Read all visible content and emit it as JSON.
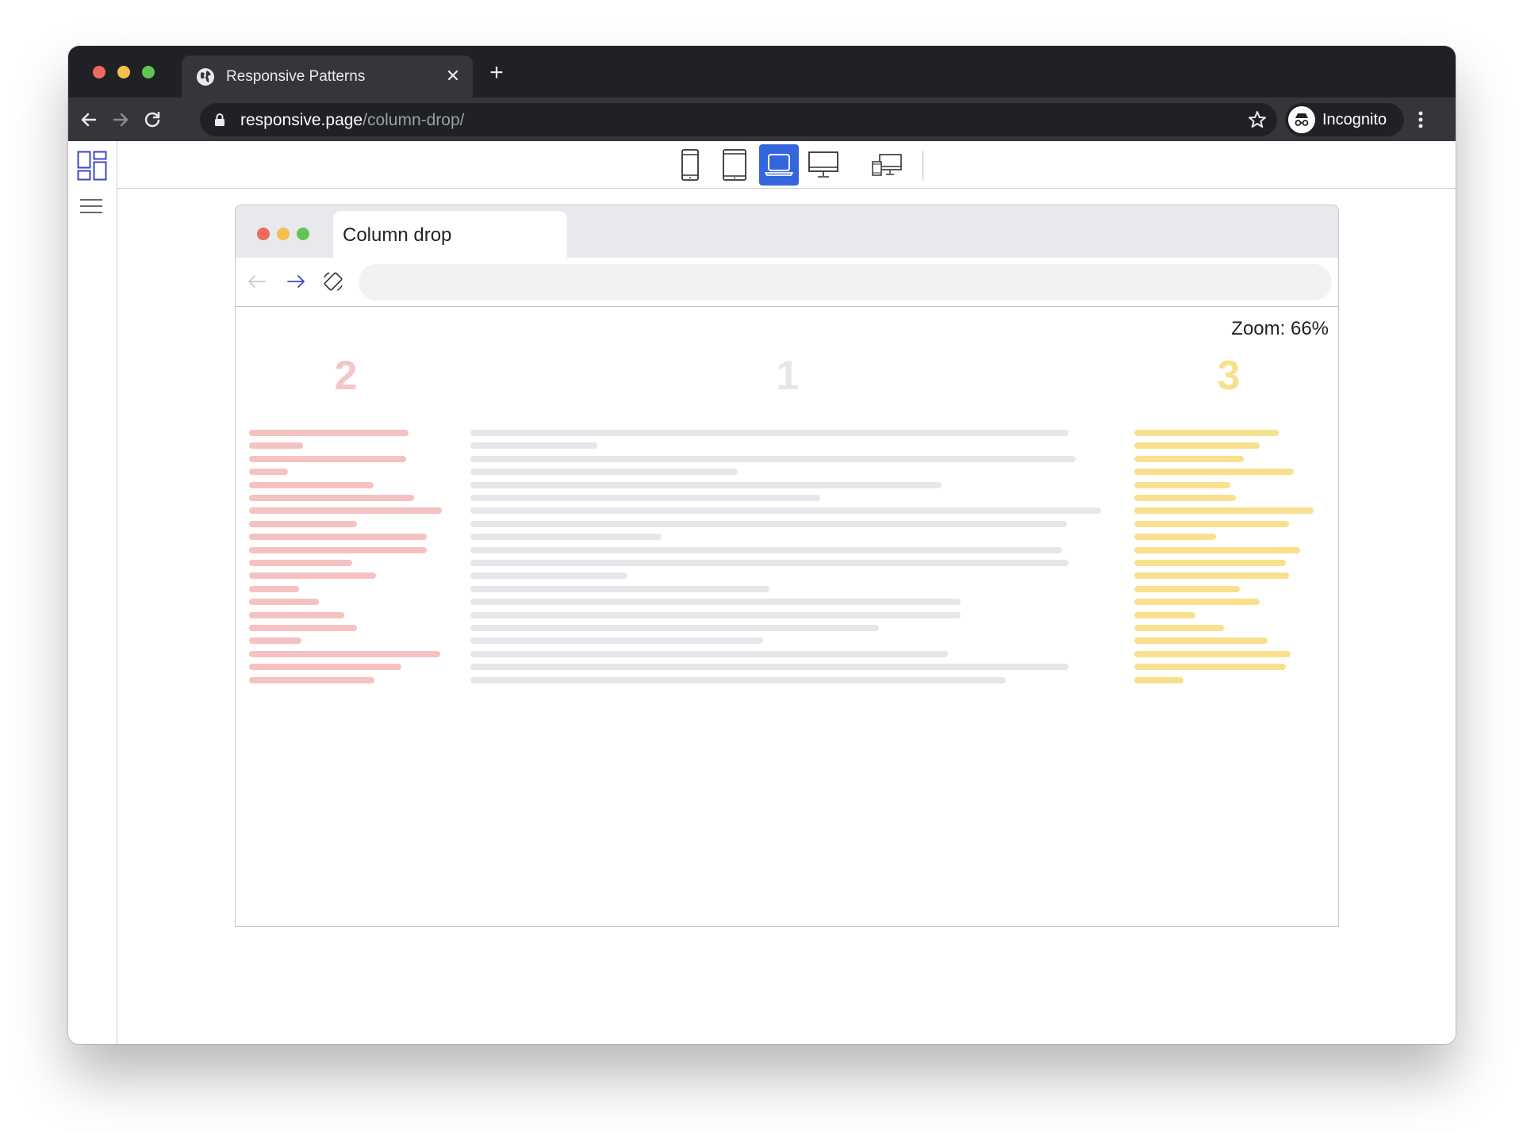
{
  "browser": {
    "tab_title": "Responsive Patterns",
    "close_glyph": "✕",
    "newtab_glyph": "+",
    "url_host": "responsive.page",
    "url_path": "/column-drop/",
    "profile_label": "Incognito"
  },
  "app": {
    "device_buttons": [
      {
        "name": "phone",
        "active": false
      },
      {
        "name": "tablet",
        "active": false
      },
      {
        "name": "laptop",
        "active": true
      },
      {
        "name": "desktop",
        "active": false
      },
      {
        "name": "multi-device",
        "active": false
      }
    ]
  },
  "mock": {
    "tab_title": "Column drop",
    "zoom_label": "Zoom: 66%",
    "address_value": "",
    "columns": [
      {
        "number": "2",
        "color": "#f5c6c6"
      },
      {
        "number": "1",
        "color": "#e6e7ea"
      },
      {
        "number": "3",
        "color": "#f8e08e"
      }
    ]
  },
  "colors": {
    "chrome_dark": "#202124",
    "chrome_toolbar": "#35363a",
    "accent_blue": "#3366dd",
    "traffic_red": "#ed6a5e",
    "traffic_yellow": "#f5bf4f",
    "traffic_green": "#61c554"
  }
}
